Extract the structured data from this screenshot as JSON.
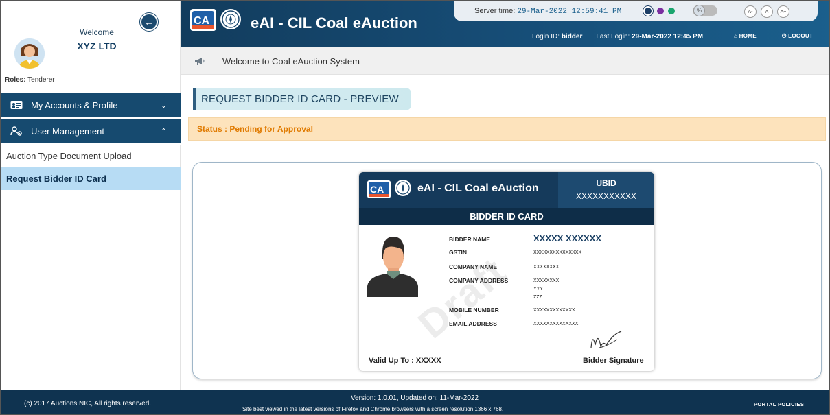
{
  "sidebar": {
    "welcome": "Welcome",
    "company": "XYZ LTD",
    "roles_label": "Roles:",
    "roles_value": "Tenderer",
    "menu": [
      {
        "label": "My Accounts & Profile",
        "expanded": false
      },
      {
        "label": "User Management",
        "expanded": true
      }
    ],
    "sub_items": [
      {
        "label": "Auction Type Document Upload",
        "active": false
      },
      {
        "label": "Request Bidder ID Card",
        "active": true
      }
    ]
  },
  "header": {
    "app_title": "eAI - CIL Coal eAuction",
    "server_time_label": "Server time:",
    "server_time": "29-Mar-2022 12:59:41 PM",
    "login_id_label": "Login ID:",
    "login_id": "bidder",
    "last_login_label": "Last Login:",
    "last_login": "29-Mar-2022 12:45 PM",
    "home": "HOME",
    "logout": "LOGOUT",
    "font_sizes": [
      "A-",
      "A",
      "A+"
    ],
    "theme_colors": [
      "#1d3f66",
      "#7b2fa0",
      "#1aa56e"
    ]
  },
  "notice": {
    "text": "Welcome to Coal eAuction System"
  },
  "main": {
    "page_title": "REQUEST BIDDER ID CARD - PREVIEW",
    "status": "Status : Pending for Approval"
  },
  "card": {
    "title": "eAI - CIL Coal eAuction",
    "ubid_label": "UBID",
    "ubid_value": "XXXXXXXXXXX",
    "band": "BIDDER ID CARD",
    "watermark": "Draft",
    "fields": [
      {
        "label": "BIDDER NAME",
        "value": "XXXXX XXXXXX"
      },
      {
        "label": "GSTIN",
        "value": "XXXXXXXXXXXXXXX"
      },
      {
        "label": "COMPANY NAME",
        "value": "XXXXXXXX"
      },
      {
        "label": "COMPANY ADDRESS",
        "value": "XXXXXXXX"
      },
      {
        "label": "MOBILE NUMBER",
        "value": "XXXXXXXXXXXXX"
      },
      {
        "label": "EMAIL ADDRESS",
        "value": "XXXXXXXXXXXXXX"
      }
    ],
    "address_extra": [
      "YYY",
      "ZZZ"
    ],
    "valid_up_to": "Valid Up To : XXXXX",
    "signature_label": "Bidder Signature"
  },
  "footer": {
    "copyright": "(c) 2017 Auctions NIC, All rights reserved.",
    "version": "Version: 1.0.01, Updated on: 11-Mar-2022",
    "best_viewed": "Site best viewed in the latest versions of Firefox and Chrome browsers with a screen resolution 1366 x 768.",
    "policies": "PORTAL POLICIES"
  }
}
